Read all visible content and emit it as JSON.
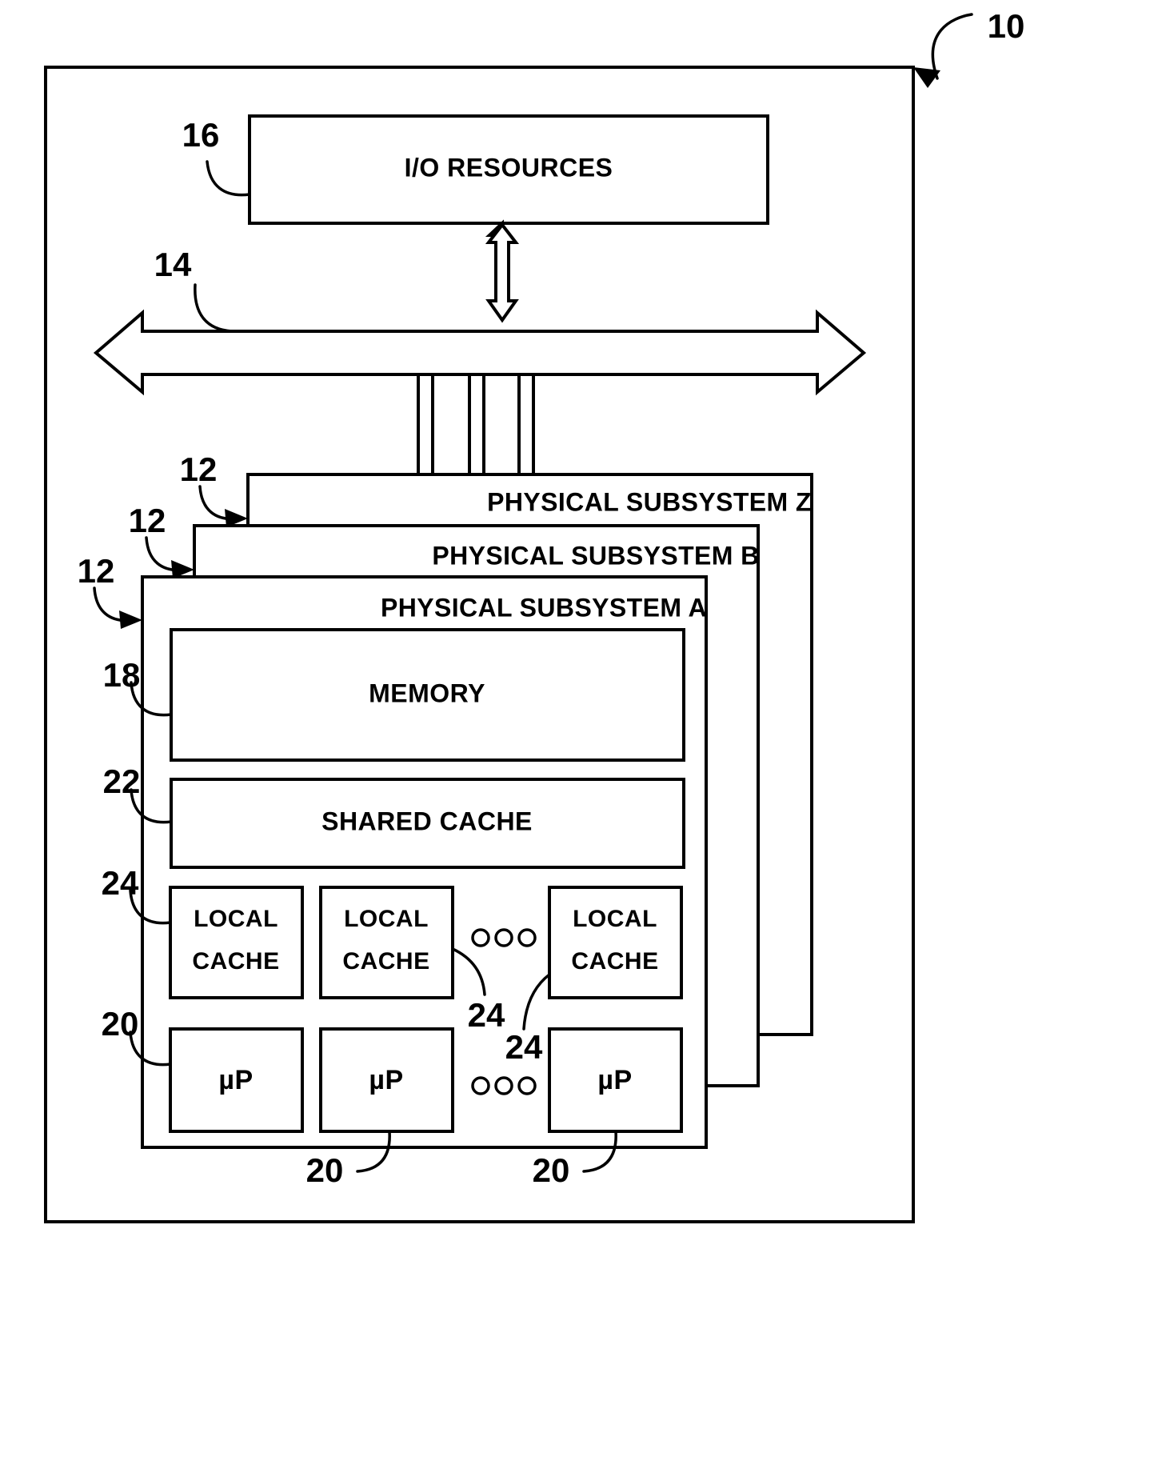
{
  "figure": {
    "reference_numerals": {
      "system": "10",
      "subsystem": "12",
      "bus": "14",
      "io_resources": "16",
      "memory": "18",
      "microprocessor": "20",
      "shared_cache": "22",
      "local_cache": "24"
    },
    "io_resources": {
      "label": "I/O RESOURCES",
      "ref": "16"
    },
    "bus": {
      "ref": "14"
    },
    "system": {
      "ref": "10"
    },
    "subsystems": [
      {
        "title": "PHYSICAL SUBSYSTEM Z",
        "ref": "12"
      },
      {
        "title": "PHYSICAL SUBSYSTEM B",
        "ref": "12"
      },
      {
        "title": "PHYSICAL SUBSYSTEM A",
        "ref": "12"
      }
    ],
    "subsystem_a": {
      "memory": {
        "label": "MEMORY",
        "ref": "18"
      },
      "shared_cache": {
        "label": "SHARED CACHE",
        "ref": "22"
      },
      "local_caches": [
        {
          "line1": "LOCAL",
          "line2": "CACHE",
          "ref": "24"
        },
        {
          "line1": "LOCAL",
          "line2": "CACHE",
          "ref": "24"
        },
        {
          "line1": "LOCAL",
          "line2": "CACHE",
          "ref": "24"
        }
      ],
      "processors": [
        {
          "label": "µP",
          "ref": "20"
        },
        {
          "label": "µP",
          "ref": "20"
        },
        {
          "label": "µP",
          "ref": "20"
        }
      ],
      "ellipsis": "○ ○ ○"
    },
    "ref_labels": {
      "n10": "10",
      "n12a": "12",
      "n12b": "12",
      "n12c": "12",
      "n14": "14",
      "n16": "16",
      "n18": "18",
      "n20_left": "20",
      "n20_mid": "20",
      "n20_right": "20",
      "n22": "22",
      "n24_left": "24",
      "n24_mid": "24",
      "n24_right": "24"
    },
    "colors": {
      "ink": "#000000",
      "paper": "#ffffff"
    }
  }
}
